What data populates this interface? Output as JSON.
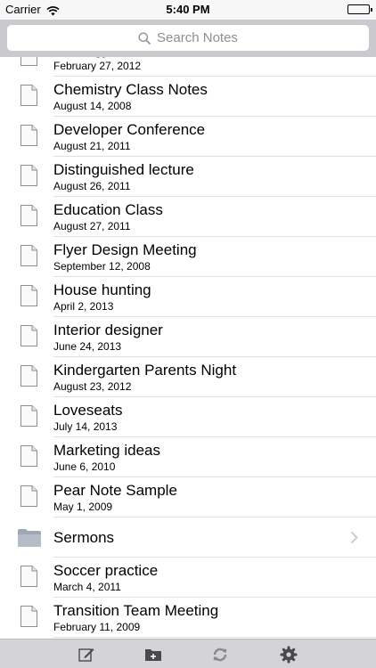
{
  "status_bar": {
    "carrier": "Carrier",
    "time": "5:40 PM"
  },
  "search": {
    "placeholder": "Search Notes"
  },
  "notes": [
    {
      "type": "note",
      "title": "Strategy",
      "date": "February 27, 2012"
    },
    {
      "type": "note",
      "title": "Chemistry Class Notes",
      "date": "August 14, 2008"
    },
    {
      "type": "note",
      "title": "Developer Conference",
      "date": "August 21, 2011"
    },
    {
      "type": "note",
      "title": "Distinguished lecture",
      "date": "August 26, 2011"
    },
    {
      "type": "note",
      "title": "Education Class",
      "date": "August 27, 2011"
    },
    {
      "type": "note",
      "title": "Flyer Design Meeting",
      "date": "September 12, 2008"
    },
    {
      "type": "note",
      "title": "House hunting",
      "date": "April 2, 2013"
    },
    {
      "type": "note",
      "title": "Interior designer",
      "date": "June 24, 2013"
    },
    {
      "type": "note",
      "title": "Kindergarten Parents Night",
      "date": "August 23, 2012"
    },
    {
      "type": "note",
      "title": "Loveseats",
      "date": "July 14, 2013"
    },
    {
      "type": "note",
      "title": "Marketing ideas",
      "date": "June 6, 2010"
    },
    {
      "type": "note",
      "title": "Pear Note Sample",
      "date": "May 1, 2009"
    },
    {
      "type": "folder",
      "title": "Sermons",
      "date": ""
    },
    {
      "type": "note",
      "title": "Soccer practice",
      "date": "March 4, 2011"
    },
    {
      "type": "note",
      "title": "Transition Team Meeting",
      "date": "February 11, 2009"
    }
  ],
  "toolbar": {
    "icons": [
      "compose-icon",
      "new-folder-icon",
      "sync-icon",
      "settings-icon"
    ]
  },
  "colors": {
    "search_bar_bg": "#c9c9ce",
    "toolbar_bg": "#d4d4d8",
    "separator": "#e0e0e0",
    "placeholder": "#8e8e93"
  }
}
